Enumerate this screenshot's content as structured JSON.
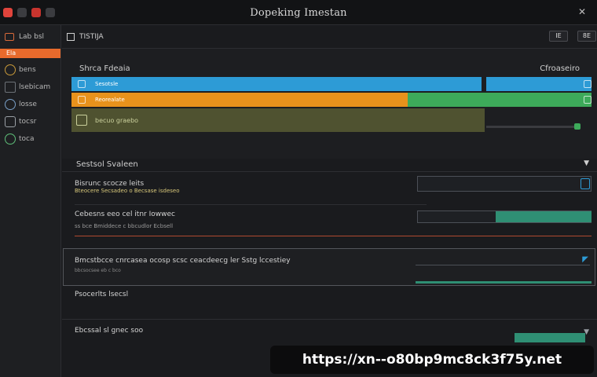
{
  "window": {
    "title": "Dopeking Imestan"
  },
  "sidebar": {
    "header_label": "Lab bsl",
    "active_label": "Ela",
    "items": [
      {
        "label": "bens",
        "icon": "gauge-icon"
      },
      {
        "label": "lsebicam",
        "icon": "list-icon"
      },
      {
        "label": "losse",
        "icon": "lock-icon"
      },
      {
        "label": "tocsr",
        "icon": "chip-icon"
      },
      {
        "label": "toca",
        "icon": "search-icon"
      }
    ]
  },
  "toolbar": {
    "label": "TISTIJA",
    "btn1": "IE",
    "btn2": "8E"
  },
  "panel": {
    "title_left": "Shrca Fdeaia",
    "title_right": "Cfroaseiro",
    "bars": [
      {
        "label": "Sesotsle",
        "color": "#2d9bd6"
      },
      {
        "label": "Reorealate",
        "color": "#e8921c"
      },
      {
        "label": "becuo graebo",
        "color": "#4f5230"
      }
    ]
  },
  "section": {
    "title": "Sestsol Svaleen"
  },
  "rows": [
    {
      "title": "Bisrunc scocze leits",
      "sub": "Bteocere Secsadeo o Becsase isdeseo"
    },
    {
      "title": "Cebesns eeo cel itnr Iowwec",
      "sub": "ss bce Bmiddece c bbcudlor Ecbsell"
    }
  ],
  "card": {
    "title": "Bmcstbcce cnrcasea ocosp scsc ceacdeecg ler Sstg lccestiey",
    "sub": "bbcsocsee eb c bco"
  },
  "rows2": [
    {
      "title": "Psocerlts lsecsl"
    },
    {
      "title": "Ebcssal sl gnec soo"
    }
  ],
  "watermark": "https://xn--o80bp9mc8ck3f75y.net",
  "colors": {
    "accent_orange": "#e86a2c",
    "blue": "#2d9bd6",
    "green": "#3daa5a",
    "teal": "#2f8f74"
  }
}
